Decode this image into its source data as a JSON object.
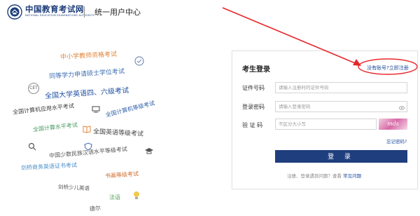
{
  "header": {
    "site_name": "中国教育考试网",
    "site_sub": "NATIONAL EDUCATION EXAMINATIONS AUTHORITY",
    "title": "统一用户中心"
  },
  "cloud": [
    {
      "text": "中小学教师资格考试",
      "color": "#e0853a"
    },
    {
      "text": "同等学力申请硕士学位考试",
      "color": "#3e6fb5"
    },
    {
      "text": "全国大学英语四、六级考试",
      "color": "#1d4fa3"
    },
    {
      "text": "全国计算机应用水平考试",
      "color": "#3d3d3d"
    },
    {
      "text": "全国计算机等级考试",
      "color": "#2b5ea8"
    },
    {
      "text": "全国计算水平考试",
      "color": "#4a9a62"
    },
    {
      "text": "全国英语等级考试",
      "color": "#444444"
    },
    {
      "text": "中国少数民族汉语水平等级考试",
      "color": "#555555"
    },
    {
      "text": "剑桥商务英语证书考试",
      "color": "#4b8fc9"
    },
    {
      "text": "书画等级考试",
      "color": "#d16b2b"
    },
    {
      "text": "剑桥少儿英语",
      "color": "#555555"
    },
    {
      "text": "法语",
      "color": "#5ba65f"
    },
    {
      "text": "德尔",
      "color": "#555555"
    }
  ],
  "cloud_icon_labels": {
    "cet": "CET"
  },
  "login": {
    "title": "考生登录",
    "register_link": "没有账号?立即注册",
    "id_label": "证件号码",
    "id_placeholder": "请输入注册时的证件号码",
    "password_label": "登录密码",
    "password_placeholder": "请输入登录密码",
    "captcha_label": "验 证 码",
    "captcha_placeholder": "不区分大小写",
    "captcha_text": "mds",
    "forgot_link": "忘记密码?",
    "login_button": "登 录",
    "help_prefix": "注册、登录遇到问题？查看",
    "help_link": "常见问题"
  },
  "colors": {
    "brand": "#1c3d7a",
    "button": "#1f3e7d",
    "link": "#1c4a9c",
    "annotation": "#e8262a"
  }
}
